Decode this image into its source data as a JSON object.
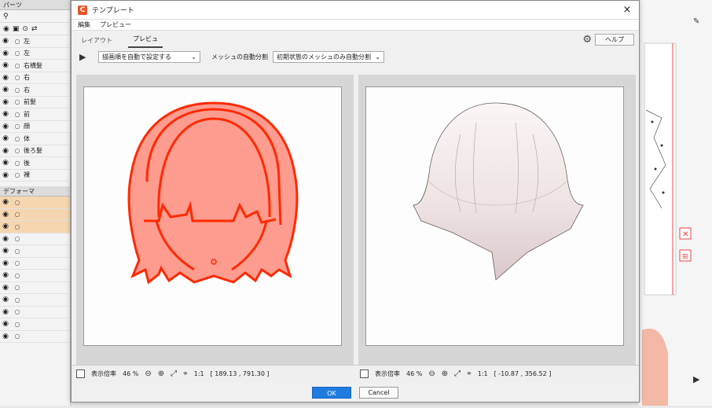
{
  "left_panel": {
    "parts_header": "パーツ",
    "deformer_header": "デフォーマ",
    "layers": [
      "左",
      "左",
      "右横髪",
      "右",
      "右",
      "前髪",
      "前",
      "顔",
      "体",
      "後ろ髪",
      "後",
      "裸"
    ]
  },
  "dialog": {
    "title": "テンプレート",
    "close_icon": "×",
    "menu": [
      "編集",
      "プレビュー"
    ],
    "tabs": [
      "レイアウト",
      "プレビュ"
    ],
    "help_label": "ヘルプ",
    "draw_order_select": "描画順を自動で設定する",
    "mesh_label": "メッシュの自動分割",
    "mesh_select": "初期状態のメッシュのみ自動分割",
    "left_status": {
      "zoom_label": "表示倍率",
      "zoom_value": "46 %",
      "one_to_one": "1:1",
      "coords": "[ 189.13 , 791.30 ]"
    },
    "right_status": {
      "zoom_label": "表示倍率",
      "zoom_value": "46 %",
      "one_to_one": "1:1",
      "coords": "[ -10.87 , 356.52 ]"
    },
    "ok_label": "OK",
    "cancel_label": "Cancel"
  },
  "colors": {
    "accent": "#1f7be0",
    "mesh_red": "#ff2a00",
    "mesh_fill": "#ff9c90"
  }
}
